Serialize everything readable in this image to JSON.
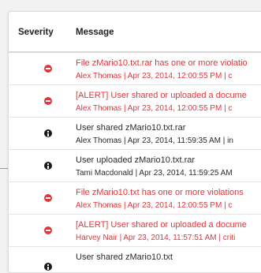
{
  "table": {
    "headers": {
      "severity": "Severity",
      "message": "Message"
    },
    "rows": [
      {
        "severity": "critical",
        "title": "File zMario10.txt.rar has one or more violatio",
        "meta": "Alex Thomas | Apr 23, 2014, 12:00:55 PM | c"
      },
      {
        "severity": "critical",
        "title": "[ALERT] User shared or uploaded a docume",
        "meta": "Alex Thomas | Apr 23, 2014, 12:00:55 PM | c"
      },
      {
        "severity": "info",
        "title": "User shared zMario10.txt.rar",
        "meta": "Alex Thomas | Apr 23, 2014, 11:59:35 AM | in"
      },
      {
        "severity": "info",
        "title": "User uploaded zMario10.txt.rar",
        "meta": "Tami Macdonald | Apr 23, 2014, 11:59:25 AM"
      },
      {
        "severity": "critical",
        "title": "File zMario10.txt has one or more violations",
        "meta": "Alex Thomas | Apr 23, 2014, 12:00:55 PM | c"
      },
      {
        "severity": "critical",
        "title": "[ALERT] User shared or uploaded a docume",
        "meta": "Harvey Nair | Apr 23, 2014, 11:57:51 AM | criti"
      },
      {
        "severity": "info",
        "title": "User shared zMario10.txt",
        "meta": ""
      }
    ]
  },
  "colors": {
    "critical": "#e0363b",
    "info": "#1a1a1a"
  },
  "icons": {
    "critical": "minus-circle-icon",
    "info": "info-circle-icon"
  }
}
